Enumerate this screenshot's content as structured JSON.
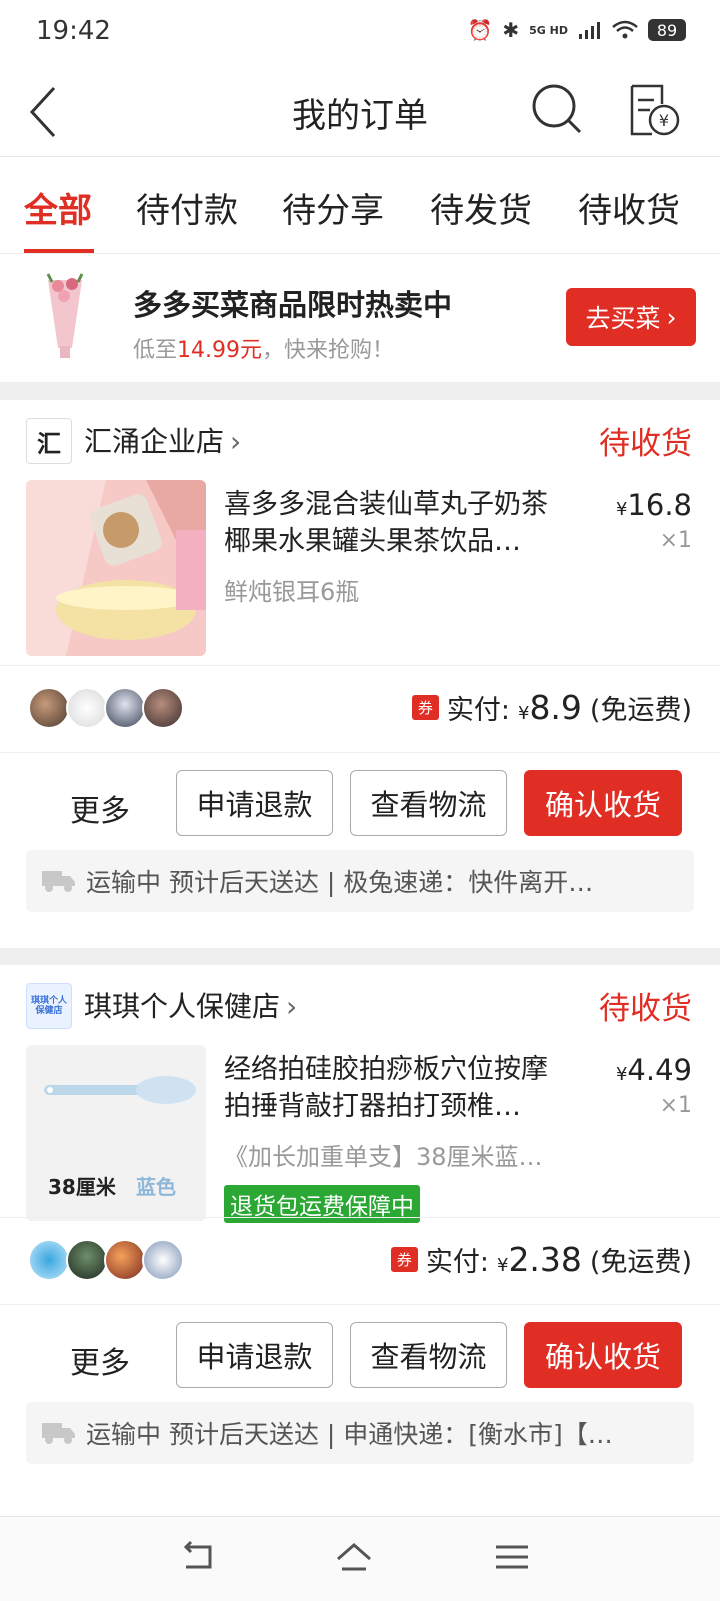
{
  "status_bar": {
    "time": "19:42",
    "network": "5G HD",
    "battery": "89"
  },
  "nav": {
    "title": "我的订单"
  },
  "tabs": [
    "全部",
    "待付款",
    "待分享",
    "待发货",
    "待收货"
  ],
  "promo": {
    "title": "多多买菜商品限时热卖中",
    "sub_prefix": "低至",
    "sub_price": "14.99元",
    "sub_suffix": "，快来抢购！",
    "button": "去买菜"
  },
  "orders": [
    {
      "shop_logo_text": "汇",
      "shop_name": "汇涌企业店",
      "status": "待收货",
      "product_title": "喜多多混合装仙草丸子奶茶椰果水果罐头果茶饮品…",
      "spec": "鲜炖银耳6瓶",
      "price_symbol": "¥",
      "price": "16.8",
      "qty": "×1",
      "coupon": "券",
      "paid_label": "实付:",
      "paid_symbol": "¥",
      "paid_amount": "8.9",
      "paid_note": "(免运费)",
      "more": "更多",
      "btn_refund": "申请退款",
      "btn_logistics": "查看物流",
      "btn_confirm": "确认收货",
      "logistics": "运输中 预计后天送达 | 极兔速递：快件离开…"
    },
    {
      "shop_logo_text": "琪琪个人保健店",
      "shop_name": "琪琪个人保健店",
      "status": "待收货",
      "product_title": "经络拍硅胶拍痧板穴位按摩拍捶背敲打器拍打颈椎…",
      "spec": "《加长加重单支】38厘米蓝…",
      "img_label_1": "38厘米",
      "img_label_2": "蓝色",
      "badge": "退货包运费保障中",
      "price_symbol": "¥",
      "price": "4.49",
      "qty": "×1",
      "coupon": "券",
      "paid_label": "实付:",
      "paid_symbol": "¥",
      "paid_amount": "2.38",
      "paid_note": "(免运费)",
      "more": "更多",
      "btn_refund": "申请退款",
      "btn_logistics": "查看物流",
      "btn_confirm": "确认收货",
      "logistics": "运输中 预计后天送达 | 申通快递：[衡水市]【…"
    }
  ],
  "colors": {
    "accent": "#e02e24",
    "green_badge": "#2aa833"
  },
  "icons": [
    "back-arrow-icon",
    "search-icon",
    "bill-yen-icon",
    "truck-icon",
    "nav-back-icon",
    "nav-home-icon",
    "nav-menu-icon"
  ]
}
